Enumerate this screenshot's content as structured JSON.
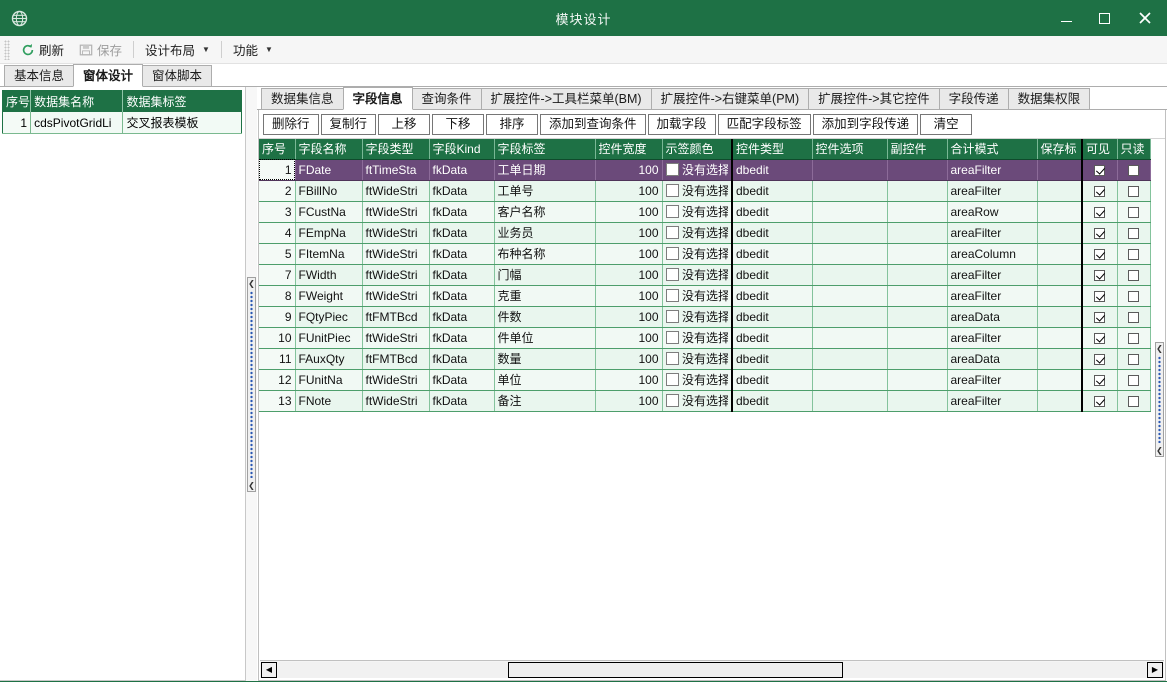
{
  "window": {
    "title": "模块设计",
    "icon": "globe-icon",
    "minimize": "–",
    "maximize": "□",
    "close": "✕",
    "accent": "#1e7145",
    "selection_color": "#6b4a7a"
  },
  "toolbar": {
    "refresh_label": "刷新",
    "refresh_icon": "refresh-icon",
    "save_label": "保存",
    "save_icon": "save-icon",
    "layout_label": "设计布局",
    "feature_label": "功能",
    "caret": "▼"
  },
  "outer_tabs": [
    {
      "label": "基本信息",
      "active": false
    },
    {
      "label": "窗体设计",
      "active": true
    },
    {
      "label": "窗体脚本",
      "active": false
    }
  ],
  "dataset_panel": {
    "columns": [
      "序号",
      "数据集名称",
      "数据集标签"
    ],
    "rows": [
      {
        "index": "1",
        "name": "cdsPivotGridLi",
        "label": "交叉报表模板"
      }
    ]
  },
  "inner_tabs": [
    {
      "label": "数据集信息",
      "active": false
    },
    {
      "label": "字段信息",
      "active": true
    },
    {
      "label": "查询条件",
      "active": false
    },
    {
      "label": "扩展控件->工具栏菜单(BM)",
      "active": false
    },
    {
      "label": "扩展控件->右键菜单(PM)",
      "active": false
    },
    {
      "label": "扩展控件->其它控件",
      "active": false
    },
    {
      "label": "字段传递",
      "active": false
    },
    {
      "label": "数据集权限",
      "active": false
    }
  ],
  "grid_toolbar": [
    "删除行",
    "复制行",
    "上移",
    "下移",
    "排序",
    "添加到查询条件",
    "加载字段",
    "匹配字段标签",
    "添加到字段传递",
    "清空"
  ],
  "field_grid": {
    "columns": [
      "序号",
      "字段名称",
      "字段类型",
      "字段Kind",
      "字段标签",
      "控件宽度",
      "示签颜色",
      "控件类型",
      "控件选项",
      "副控件",
      "合计模式",
      "保存标",
      "可见",
      "只读"
    ],
    "color_placeholder": "没有选择",
    "rows": [
      {
        "idx": "1",
        "name": "FDate",
        "type": "ftTimeSta",
        "kind": "fkData",
        "label": "工单日期",
        "width": "100",
        "color": "没有选择",
        "ctrl": "dbedit",
        "opt": "",
        "subctrl": "",
        "total": "areaFilter",
        "save": "",
        "visible": true,
        "readonly": false,
        "selected": true
      },
      {
        "idx": "2",
        "name": "FBillNo",
        "type": "ftWideStri",
        "kind": "fkData",
        "label": "工单号",
        "width": "100",
        "color": "没有选择",
        "ctrl": "dbedit",
        "opt": "",
        "subctrl": "",
        "total": "areaFilter",
        "save": "",
        "visible": true,
        "readonly": false,
        "selected": false
      },
      {
        "idx": "3",
        "name": "FCustNa",
        "type": "ftWideStri",
        "kind": "fkData",
        "label": "客户名称",
        "width": "100",
        "color": "没有选择",
        "ctrl": "dbedit",
        "opt": "",
        "subctrl": "",
        "total": "areaRow",
        "save": "",
        "visible": true,
        "readonly": false,
        "selected": false
      },
      {
        "idx": "4",
        "name": "FEmpNa",
        "type": "ftWideStri",
        "kind": "fkData",
        "label": "业务员",
        "width": "100",
        "color": "没有选择",
        "ctrl": "dbedit",
        "opt": "",
        "subctrl": "",
        "total": "areaFilter",
        "save": "",
        "visible": true,
        "readonly": false,
        "selected": false
      },
      {
        "idx": "5",
        "name": "FItemNa",
        "type": "ftWideStri",
        "kind": "fkData",
        "label": "布种名称",
        "width": "100",
        "color": "没有选择",
        "ctrl": "dbedit",
        "opt": "",
        "subctrl": "",
        "total": "areaColumn",
        "save": "",
        "visible": true,
        "readonly": false,
        "selected": false
      },
      {
        "idx": "7",
        "name": "FWidth",
        "type": "ftWideStri",
        "kind": "fkData",
        "label": "门幅",
        "width": "100",
        "color": "没有选择",
        "ctrl": "dbedit",
        "opt": "",
        "subctrl": "",
        "total": "areaFilter",
        "save": "",
        "visible": true,
        "readonly": false,
        "selected": false
      },
      {
        "idx": "8",
        "name": "FWeight",
        "type": "ftWideStri",
        "kind": "fkData",
        "label": "克重",
        "width": "100",
        "color": "没有选择",
        "ctrl": "dbedit",
        "opt": "",
        "subctrl": "",
        "total": "areaFilter",
        "save": "",
        "visible": true,
        "readonly": false,
        "selected": false
      },
      {
        "idx": "9",
        "name": "FQtyPiec",
        "type": "ftFMTBcd",
        "kind": "fkData",
        "label": "件数",
        "width": "100",
        "color": "没有选择",
        "ctrl": "dbedit",
        "opt": "",
        "subctrl": "",
        "total": "areaData",
        "save": "",
        "visible": true,
        "readonly": false,
        "selected": false
      },
      {
        "idx": "10",
        "name": "FUnitPiec",
        "type": "ftWideStri",
        "kind": "fkData",
        "label": "件单位",
        "width": "100",
        "color": "没有选择",
        "ctrl": "dbedit",
        "opt": "",
        "subctrl": "",
        "total": "areaFilter",
        "save": "",
        "visible": true,
        "readonly": false,
        "selected": false
      },
      {
        "idx": "11",
        "name": "FAuxQty",
        "type": "ftFMTBcd",
        "kind": "fkData",
        "label": "数量",
        "width": "100",
        "color": "没有选择",
        "ctrl": "dbedit",
        "opt": "",
        "subctrl": "",
        "total": "areaData",
        "save": "",
        "visible": true,
        "readonly": false,
        "selected": false
      },
      {
        "idx": "12",
        "name": "FUnitNa",
        "type": "ftWideStri",
        "kind": "fkData",
        "label": "单位",
        "width": "100",
        "color": "没有选择",
        "ctrl": "dbedit",
        "opt": "",
        "subctrl": "",
        "total": "areaFilter",
        "save": "",
        "visible": true,
        "readonly": false,
        "selected": false
      },
      {
        "idx": "13",
        "name": "FNote",
        "type": "ftWideStri",
        "kind": "fkData",
        "label": "备注",
        "width": "100",
        "color": "没有选择",
        "ctrl": "dbedit",
        "opt": "",
        "subctrl": "",
        "total": "areaFilter",
        "save": "",
        "visible": true,
        "readonly": false,
        "selected": false
      }
    ]
  },
  "scrollbar": {
    "left_arrow": "◀",
    "right_arrow": "▶"
  },
  "splitter": {
    "arrow": "❮"
  }
}
